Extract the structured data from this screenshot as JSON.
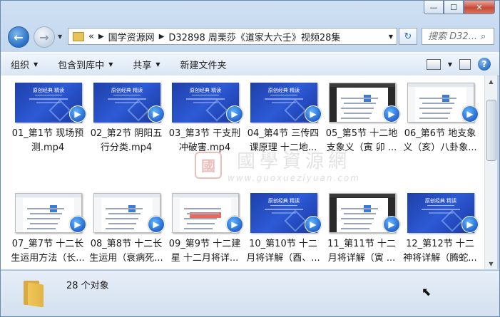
{
  "titlebar": {
    "min": "—",
    "max": "☐",
    "close": "✕"
  },
  "nav": {
    "back": "←",
    "forward": "→",
    "recent": "▼"
  },
  "address": {
    "overflow": "«",
    "crumbs": [
      "国学资源网",
      "D32898 周栗莎《道家大六壬》视频28集"
    ],
    "dropdown": "▼"
  },
  "refresh": "↻",
  "search": {
    "placeholder": "搜索 D32...",
    "icon": "search-icon"
  },
  "toolbar": {
    "organize": "组织",
    "include_library": "包含到库中",
    "share": "共享",
    "new_folder": "新建文件夹",
    "caret": "▼"
  },
  "thumb_title": "原创经典 精读",
  "files": [
    {
      "label": "01_第1节 现场预测.mp4",
      "thumb": "blue"
    },
    {
      "label": "02_第2节 阴阳五行分类.mp4",
      "thumb": "blue"
    },
    {
      "label": "03_第3节 干支刑冲破害.mp4",
      "thumb": "blue"
    },
    {
      "label": "04_第4节 三传四课原理 十二地...",
      "thumb": "blue"
    },
    {
      "label": "05_第5节 十二地支象义（寅 卯 ...",
      "thumb": "screen"
    },
    {
      "label": "06_第6节 地支象义（亥）八卦象...",
      "thumb": "screen"
    },
    {
      "label": "07_第7节 十二长生运用方法（长...",
      "thumb": "screen"
    },
    {
      "label": "08_第8节 十二长生运用（衰病死...",
      "thumb": "screen"
    },
    {
      "label": "09_第9节 十二建星 十二月将详...",
      "thumb": "screen-red"
    },
    {
      "label": "10_第10节 十二月将详解（酉、...",
      "thumb": "blue"
    },
    {
      "label": "11_第11节 十二月将详解（寅 ...",
      "thumb": "screen"
    },
    {
      "label": "12_第12节 十二神将详解（腾蛇...",
      "thumb": "blue"
    }
  ],
  "play_badge": "▶",
  "watermark": {
    "seal": "國",
    "cn": "國學資源網",
    "url": "www.guoxuezīyuan.com"
  },
  "status": {
    "count": "28 个对象"
  },
  "colors": {
    "accent": "#2a6fc4",
    "thumb_blue": "#2d5ad6",
    "close": "#c74b38"
  }
}
